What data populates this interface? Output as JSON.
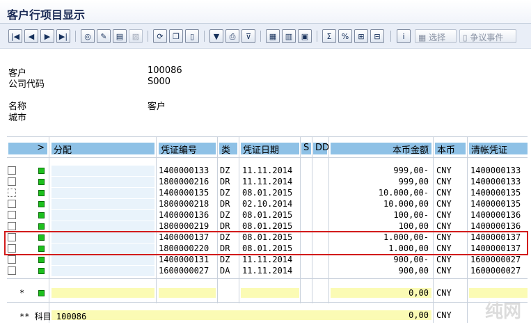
{
  "window": {
    "title": "客户行项目显示"
  },
  "toolbar": {
    "select_label": "选择",
    "dispute_label": "争议事件"
  },
  "header": {
    "customer_label": "客户",
    "customer_value": "100086",
    "company_label": "公司代码",
    "company_value": "S000",
    "name_label": "名称",
    "name_value": "客户",
    "city_label": "城市"
  },
  "columns": [
    "分配",
    "凭证编号",
    "类",
    "凭证日期",
    "S",
    "DD",
    "本币金额",
    "本币",
    "清帐凭证"
  ],
  "rows": [
    {
      "doc": "1400000133",
      "type": "DZ",
      "date": "11.11.2014",
      "amount": "999,00-",
      "currency": "CNY",
      "clearing": "1400000133"
    },
    {
      "doc": "1800000216",
      "type": "DR",
      "date": "11.11.2014",
      "amount": "999,00",
      "currency": "CNY",
      "clearing": "1400000133"
    },
    {
      "doc": "1400000135",
      "type": "DZ",
      "date": "08.01.2015",
      "amount": "10.000,00-",
      "currency": "CNY",
      "clearing": "1400000135"
    },
    {
      "doc": "1800000218",
      "type": "DR",
      "date": "02.10.2014",
      "amount": "10.000,00",
      "currency": "CNY",
      "clearing": "1400000135"
    },
    {
      "doc": "1400000136",
      "type": "DZ",
      "date": "08.01.2015",
      "amount": "100,00-",
      "currency": "CNY",
      "clearing": "1400000136"
    },
    {
      "doc": "1800000219",
      "type": "DR",
      "date": "08.01.2015",
      "amount": "100,00",
      "currency": "CNY",
      "clearing": "1400000136"
    },
    {
      "doc": "1400000137",
      "type": "DZ",
      "date": "08.01.2015",
      "amount": "1.000,00-",
      "currency": "CNY",
      "clearing": "1400000137"
    },
    {
      "doc": "1800000220",
      "type": "DR",
      "date": "08.01.2015",
      "amount": "1.000,00",
      "currency": "CNY",
      "clearing": "1400000137"
    },
    {
      "doc": "1400000131",
      "type": "DZ",
      "date": "11.11.2014",
      "amount": "900,00-",
      "currency": "CNY",
      "clearing": "1600000027"
    },
    {
      "doc": "1600000027",
      "type": "DA",
      "date": "11.11.2014",
      "amount": "900,00",
      "currency": "CNY",
      "clearing": "1600000027"
    }
  ],
  "total_row": {
    "marker": "*",
    "amount": "0,00",
    "currency": "CNY"
  },
  "subtotal_row": {
    "label": "** 科目 100086",
    "amount": "0,00",
    "currency": "CNY"
  },
  "watermark": "纯网"
}
